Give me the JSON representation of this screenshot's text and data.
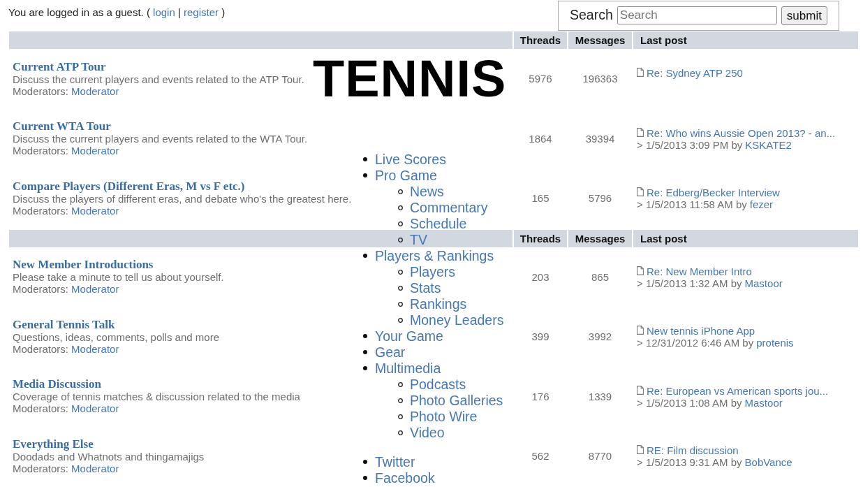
{
  "guest_notice": {
    "before": "You are logged in as a guest. (",
    "login": "login",
    "separator": "|",
    "register": "register",
    "after": ")"
  },
  "logo": "TENNIS",
  "search": {
    "label": "Search",
    "placeholder": "Search",
    "button": "submit"
  },
  "nav_menu": [
    {
      "label": "Live Scores"
    },
    {
      "label": "Pro Game",
      "children": [
        {
          "label": "News"
        },
        {
          "label": "Commentary"
        },
        {
          "label": "Schedule"
        },
        {
          "label": "TV"
        }
      ]
    },
    {
      "label": "Players & Rankings",
      "children": [
        {
          "label": "Players"
        },
        {
          "label": "Stats"
        },
        {
          "label": "Rankings"
        },
        {
          "label": "Money Leaders"
        }
      ]
    },
    {
      "label": "Your Game"
    },
    {
      "label": "Gear"
    },
    {
      "label": "Multimedia",
      "children": [
        {
          "label": "Podcasts"
        },
        {
          "label": "Photo Galleries"
        },
        {
          "label": "Photo Wire"
        },
        {
          "label": "Video"
        }
      ]
    }
  ],
  "social_links": [
    {
      "label": "Twitter"
    },
    {
      "label": "Facebook"
    }
  ],
  "forum_sections": [
    {
      "columns": [
        "Threads",
        "Messages",
        "Last post"
      ],
      "forums": [
        {
          "title": "Current ATP Tour",
          "description": "Discuss the current players and events related to the ATP Tour.",
          "moderators_label": "Moderators:",
          "moderator": "Moderator",
          "threads": "5976",
          "messages": "196363",
          "last_post": {
            "title": "Re: Sydney ATP 250"
          }
        },
        {
          "title": "Current WTA Tour",
          "description": "Discuss the current players and events related to the WTA Tour.",
          "moderators_label": "Moderators:",
          "moderator": "Moderator",
          "threads": "1864",
          "messages": "39394",
          "last_post": {
            "title": "Re: Who wins Aussie Open 2013? - an...",
            "posted": "> 1/5/2013 3:09 PM by",
            "author": "KSKATE2"
          }
        },
        {
          "title": "Compare Players (Different Eras, M vs F etc.)",
          "description": "Discuss the players of different eras, and debate who's the greatest here.",
          "moderators_label": "Moderators:",
          "moderator": "Moderator",
          "threads": "165",
          "messages": "5796",
          "last_post": {
            "title": "Re: Edberg/Becker Interview",
            "posted": "> 1/5/2013 11:58 AM by",
            "author": "fezer"
          }
        }
      ]
    },
    {
      "columns": [
        "Threads",
        "Messages",
        "Last post"
      ],
      "forums": [
        {
          "title": "New Member Introductions",
          "description": "Please take a minute to tell us about yourself.",
          "moderators_label": "Moderators:",
          "moderator": "Moderator",
          "threads": "203",
          "messages": "865",
          "last_post": {
            "title": "Re: New Member Intro",
            "posted": "> 1/5/2013 1:32 AM by",
            "author": "Mastoor"
          }
        },
        {
          "title": "General Tennis Talk",
          "description": "Questions, ideas, comments, polls and more",
          "moderators_label": "Moderators:",
          "moderator": "Moderator",
          "threads": "399",
          "messages": "3992",
          "last_post": {
            "title": "New tennis iPhone App",
            "posted": "> 12/31/2012 6:46 AM by",
            "author": "protenis"
          }
        },
        {
          "title": "Media Discussion",
          "description": "Coverage of tennis matches & discussion related to the media",
          "moderators_label": "Moderators:",
          "moderator": "Moderator",
          "threads": "176",
          "messages": "1339",
          "last_post": {
            "title": "Re: European vs American sports jou...",
            "posted": "> 1/5/2013 1:08 AM by",
            "author": "Mastoor"
          }
        },
        {
          "title": "Everything Else",
          "description": "Doodads and Whatnots and thingamajigs",
          "moderators_label": "Moderators:",
          "moderator": "Moderator",
          "threads": "562",
          "messages": "8770",
          "last_post": {
            "title": "RE: Film discussion",
            "posted": "> 1/5/2013 9:31 AM by",
            "author": "BobVance"
          }
        }
      ]
    }
  ]
}
